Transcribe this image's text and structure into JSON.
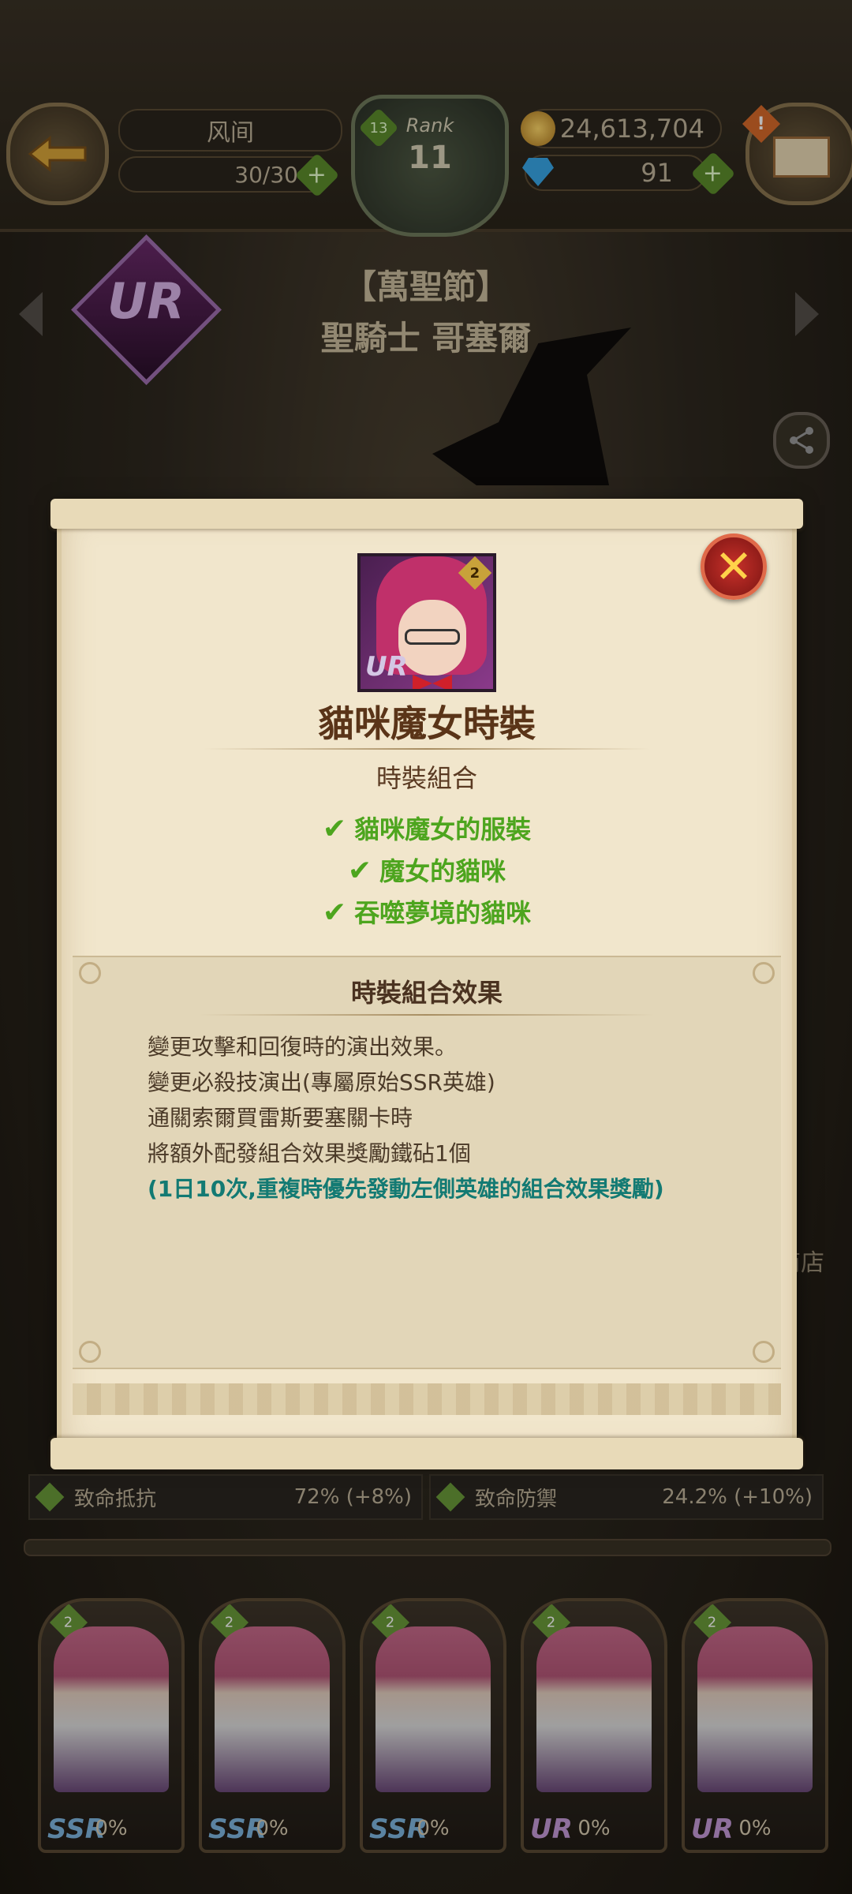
{
  "topbar": {
    "player_name": "风间",
    "stamina": "30/30",
    "rank_label": "Rank",
    "rank_value": "11",
    "level_badge": "13",
    "gold": "24,613,704",
    "gems": "91",
    "alert": "!"
  },
  "hero": {
    "title": "【萬聖節】",
    "name": "聖騎士 哥塞爾",
    "rarity": "UR"
  },
  "side": {
    "shop_label": "商店"
  },
  "stats": [
    {
      "name": "致命抵抗",
      "value": "72% (+8%)"
    },
    {
      "name": "致命防禦",
      "value": "24.2% (+10%)"
    }
  ],
  "costumes": [
    {
      "rarity": "SSR",
      "star": "2",
      "progress": "0%"
    },
    {
      "rarity": "SSR",
      "star": "2",
      "progress": "0%"
    },
    {
      "rarity": "SSR",
      "star": "2",
      "progress": "0%"
    },
    {
      "rarity": "UR",
      "star": "2",
      "progress": "0%"
    },
    {
      "rarity": "UR",
      "star": "2",
      "progress": "0%"
    }
  ],
  "modal": {
    "portrait_rarity": "UR",
    "portrait_star": "2",
    "title": "貓咪魔女時裝",
    "set_label": "時裝組合",
    "set_items": [
      "貓咪魔女的服裝",
      "魔女的貓咪",
      "吞噬夢境的貓咪"
    ],
    "effect_title": "時裝組合效果",
    "effect_lines": [
      "變更攻擊和回復時的演出效果。",
      "變更必殺技演出(專屬原始SSR英雄)",
      "通關索爾買雷斯要塞關卡時",
      "將額外配發組合效果獎勵鐵砧1個"
    ],
    "effect_note": "(1日10次,重複時優先發動左側英雄的組合效果獎勵)"
  },
  "icons": {
    "back": "back-arrow-icon",
    "mail": "envelope-icon",
    "close": "close-x-icon",
    "check": "check-icon",
    "share": "share-icon"
  }
}
